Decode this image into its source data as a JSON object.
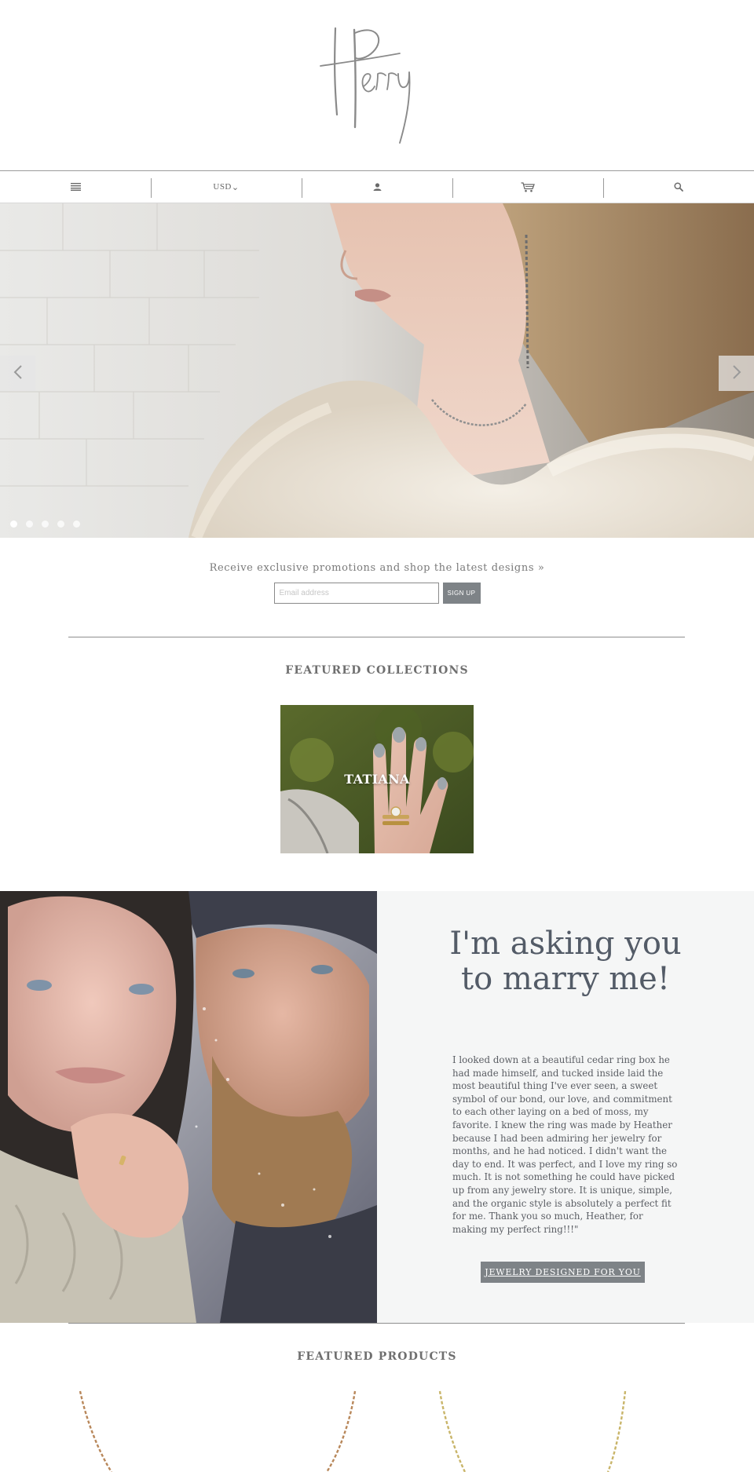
{
  "header": {
    "logo_text": "Perry"
  },
  "nav": {
    "menu_icon": "hamburger-menu-icon",
    "currency": "USD",
    "currency_caret": "⌄",
    "account_icon": "user-icon",
    "cart_icon": "cart-icon",
    "search_icon": "search-icon"
  },
  "hero": {
    "slide_count": 5,
    "active_slide": 1,
    "prev_icon": "chevron-left-icon",
    "next_icon": "chevron-right-icon"
  },
  "newsletter": {
    "text": "Receive exclusive promotions and shop the latest designs »",
    "email_placeholder": "Email address",
    "signup_label": "SIGN UP"
  },
  "featured_collections": {
    "title": "FEATURED COLLECTIONS",
    "items": [
      {
        "label": "TATIANA"
      }
    ]
  },
  "testimonial": {
    "heading": "I'm asking you to marry me!",
    "body": "I looked down at a beautiful cedar ring box he had made himself, and tucked inside laid the most beautiful thing I've ever seen, a sweet symbol of our bond, our love, and commitment to each other laying on a bed of moss, my favorite. I knew the ring was made by Heather because I had been admiring her jewelry for months, and he had noticed. I didn't want the day to end. It was perfect, and I love my ring so much. It is not something he could have picked up from any jewelry store. It is unique, simple, and the organic style is absolutely a perfect fit for me. Thank you so much, Heather, for making my perfect ring!!!\"",
    "button_label": "JEWELRY DESIGNED FOR YOU"
  },
  "featured_products": {
    "title": "FEATURED PRODUCTS"
  },
  "colors": {
    "button_bg": "#7e8387",
    "heading_text": "#535b67",
    "panel_bg": "#f5f6f6"
  }
}
